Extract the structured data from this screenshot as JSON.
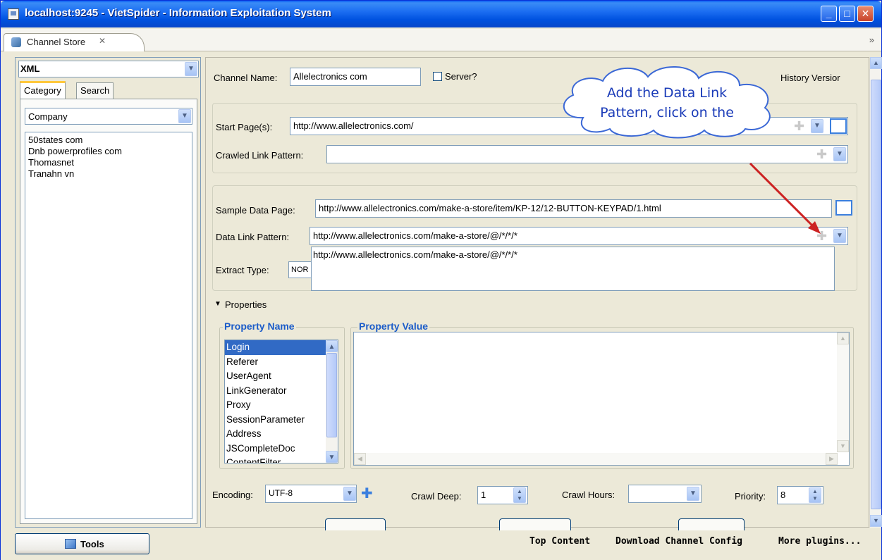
{
  "window": {
    "title": "localhost:9245 - VietSpider - Information Exploitation System",
    "buttons": [
      "_",
      "□",
      "✕"
    ]
  },
  "view": {
    "tab_label": "Channel Store",
    "tab_close": "✕",
    "chevrons": "»"
  },
  "left": {
    "type_combo": "XML",
    "tabs": [
      "Category",
      "Search"
    ],
    "category_combo": "Company",
    "items": [
      "50states com",
      "Dnb powerprofiles com",
      "Thomasnet",
      "Tranahn vn"
    ]
  },
  "form": {
    "channel_name_label": "Channel Name:",
    "channel_name_value": "Allelectronics com",
    "server_label": "Server?",
    "history_label": "History Versior",
    "start_pages_label": "Start Page(s):",
    "start_pages_value": "http://www.allelectronics.com/",
    "crawled_link_label": "Crawled Link Pattern:",
    "crawled_link_value": "",
    "sample_page_label": "Sample Data Page:",
    "sample_page_value": "http://www.allelectronics.com/make-a-store/item/KP-12/12-BUTTON-KEYPAD/1.html",
    "data_link_label": "Data Link Pattern:",
    "data_link_value": "http://www.allelectronics.com/make-a-store/@/*/*/*",
    "popup_item": "http://www.allelectronics.com/make-a-store/@/*/*/*",
    "extract_type_label": "Extract Type:",
    "extract_type_value": "NOR"
  },
  "properties": {
    "toggle_label": "Properties",
    "name_header": "Property Name",
    "value_header": "Property Value",
    "names": [
      "Login",
      "Referer",
      "UserAgent",
      "LinkGenerator",
      "Proxy",
      "SessionParameter",
      "Address",
      "JSCompleteDoc",
      "ContentFilter"
    ],
    "selected": "Login"
  },
  "settings": {
    "encoding_label": "Encoding:",
    "encoding_value": "UTF-8",
    "crawl_deep_label": "Crawl Deep:",
    "crawl_deep_value": "1",
    "crawl_hours_label": "Crawl Hours:",
    "crawl_hours_value": "",
    "priority_label": "Priority:",
    "priority_value": "8"
  },
  "callout": {
    "line1": "Add the Data Link",
    "line2": "Pattern, click on the"
  },
  "bottom": {
    "tools_label": "Tools",
    "links": [
      "Top Content",
      "Download Channel Config",
      "More plugins..."
    ]
  },
  "colors": {
    "title_bar": "#0054e3",
    "accent_blue": "#3b7fde",
    "arrow_red": "#cc2222",
    "callout_text": "#1a3bb8"
  }
}
